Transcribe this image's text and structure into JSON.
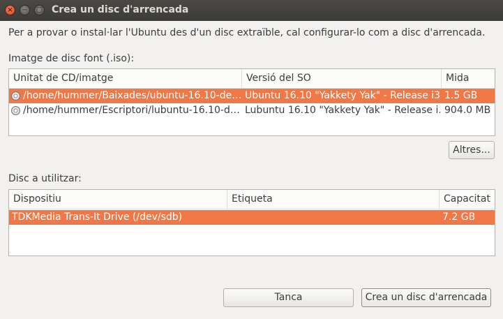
{
  "window": {
    "title": "Crea un disc d'arrencada",
    "close_glyph": "×",
    "minimize_glyph": "−",
    "maximize_glyph": "□"
  },
  "intro_text": "Per a provar o instal·lar l'Ubuntu des d'un disc extraïble, cal configurar-lo com a disc d'arrencada.",
  "source": {
    "label": "Imatge de disc font (.iso):",
    "columns": [
      "Unitat de CD/imatge",
      "Versió del SO",
      "Mida"
    ],
    "rows": [
      {
        "path": "/home/hummer/Baixades/ubuntu-16.10-de…",
        "version": "Ubuntu 16.10 \"Yakkety Yak\" - Release i3…",
        "size": "1.5 GB",
        "selected": true,
        "icon": "cd-disc-icon"
      },
      {
        "path": "/home/hummer/Escriptori/lubuntu-16.10-d…",
        "version": "Lubuntu 16.10 \"Yakkety Yak\" - Release i…",
        "size": "904.0 MB",
        "selected": false,
        "icon": "cd-disc-icon"
      }
    ],
    "other_button": "Altres..."
  },
  "target": {
    "label": "Disc a utilitzar:",
    "columns": [
      "Dispositiu",
      "Etiqueta",
      "Capacitat"
    ],
    "rows": [
      {
        "device": "TDKMedia Trans-It Drive (/dev/sdb)",
        "label": "",
        "capacity": "7.2 GB",
        "selected": true
      }
    ]
  },
  "buttons": {
    "cancel": "Tanca",
    "create": "Crea un disc d'arrencada"
  },
  "colors": {
    "selection": "#f07746",
    "titlebar": "#3c3b37"
  }
}
